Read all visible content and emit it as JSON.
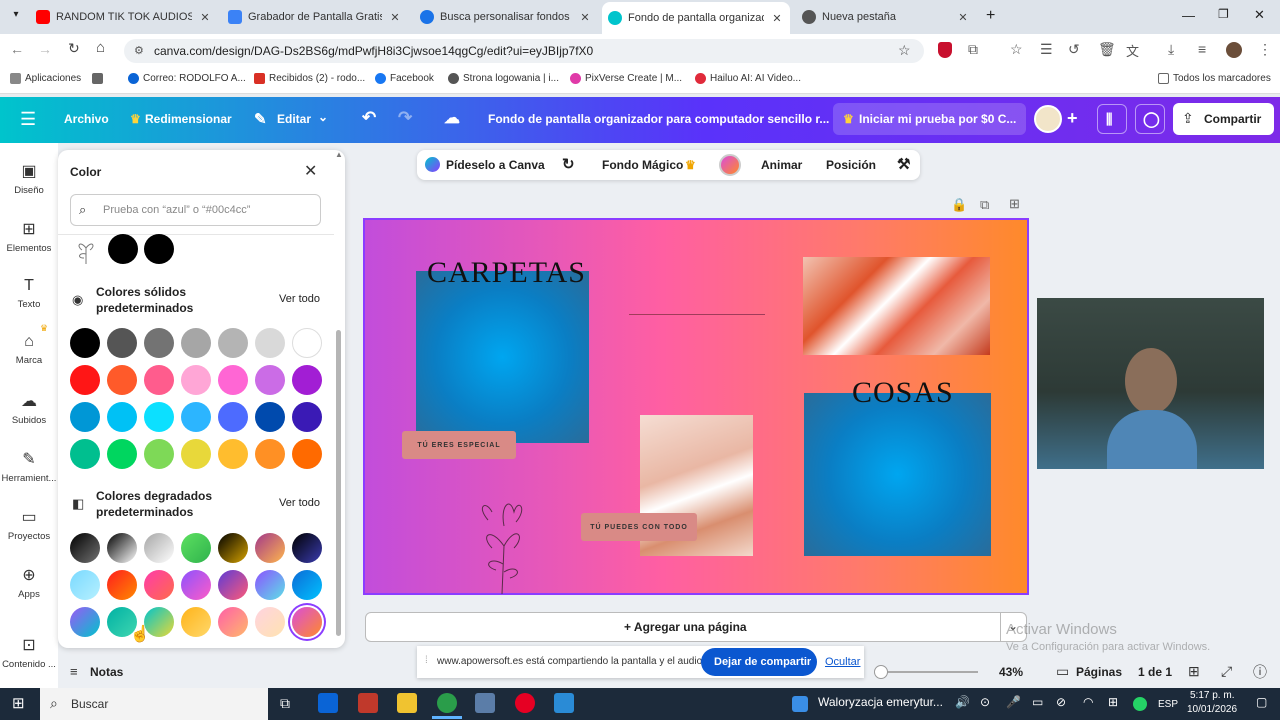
{
  "browser": {
    "tabs": [
      {
        "title": "RANDOM TIK TOK AUDIOS",
        "color": "#ff0000"
      },
      {
        "title": "Grabador de Pantalla Gratis",
        "color": "#3b82f6"
      },
      {
        "title": "Busca personalisar fondos de p",
        "color": "#1a73e8"
      },
      {
        "title": "Fondo de pantalla organizador",
        "color": "#00c4cc"
      },
      {
        "title": "Nueva pestaña",
        "color": "#555555"
      }
    ],
    "new_tab": "+",
    "url": "canva.com/design/DAG-Ds2BS6g/mdPwfjH8i3Cjwsoe14qgCg/edit?ui=eyJBIjp7fX0",
    "bookmarks": [
      "Aplicaciones",
      "Correo: RODOLFO A...",
      "Recibidos (2) - rodo...",
      "Facebook",
      "Strona logowania | i...",
      "PixVerse Create | M...",
      "Hailuo AI: AI Video...",
      "Todos los marcadores"
    ]
  },
  "canva_header": {
    "archivo": "Archivo",
    "redimensionar": "Redimensionar",
    "editar": "Editar",
    "doc_title": "Fondo de pantalla organizador para computador sencillo r...",
    "trial": "Iniciar mi prueba por $0 C...",
    "share": "Compartir"
  },
  "rail": [
    "Diseño",
    "Elementos",
    "Texto",
    "Marca",
    "Subidos",
    "Herramient...",
    "Proyectos",
    "Apps",
    "Contenido ..."
  ],
  "panel": {
    "title": "Color",
    "search_placeholder": "Prueba con “azul” o “#00c4cc”",
    "solid_title": "Colores sólidos predeterminados",
    "gradient_title": "Colores degradados predeterminados",
    "see_all": "Ver todo",
    "solid_colors": [
      [
        "#000000",
        "#555555",
        "#737373",
        "#a6a6a6",
        "#b4b4b4",
        "#d9d9d9",
        "#ffffff"
      ],
      [
        "#ff1616",
        "#ff5a2a",
        "#ff5c8d",
        "#ffa6d6",
        "#ff66d4",
        "#cb6ce6",
        "#a21ed4"
      ],
      [
        "#0097d6",
        "#00c1f5",
        "#0ce0ff",
        "#2cb5ff",
        "#4d6bff",
        "#004aad",
        "#3a1ab5"
      ],
      [
        "#00bf8f",
        "#00d65f",
        "#7ed957",
        "#e8d83a",
        "#ffbd2e",
        "#ff9024",
        "#ff6a00"
      ]
    ],
    "gradients": [
      [
        "#000000,#737373",
        "#000000,#ffffff",
        "#a6a6a6,#ffffff",
        "#5de060,#2fb34d",
        "#000000,#d6a200",
        "#a2378a,#ffb74d",
        "#000000,#3a3cb0"
      ],
      [
        "#7ad9ff,#b6f0ff",
        "#ff1d1d,#ff8a00",
        "#ff3bab,#ff6b4a",
        "#8c52ff,#ff5cc7",
        "#5c3bd6,#ff5a77",
        "#8c52ff,#5ce1e6",
        "#0c6bd6,#00c2ff"
      ],
      [
        "#9b59f5,#00c4cc",
        "#00b1a4,#3fd6b0",
        "#00c4cc,#e9d836",
        "#ffb319,#ffd86b",
        "#ff5fa8,#ffb86b",
        "#ffd3e0,#ffe3b0",
        "#d94dda,#ff8a2a"
      ]
    ]
  },
  "toolbar": {
    "pideselo": "Pídeselo a Canva",
    "fondo": "Fondo Mágico",
    "animar": "Animar",
    "posicion": "Posición"
  },
  "canvas": {
    "carpetas": "CARPETAS",
    "cosas": "COSAS",
    "tag1": "TÚ ERES ESPECIAL",
    "tag2": "TÚ PUEDES CON TODO"
  },
  "bottom": {
    "add_page": "+ Agregar una página",
    "share_msg": "www.apowersoft.es está compartiendo la pantalla y el audio.",
    "stop_share": "Dejar de compartir",
    "hide": "Ocultar",
    "notes": "Notas",
    "zoom": "43%",
    "pages": "Páginas",
    "page_count": "1 de 1",
    "activate1": "Activar Windows",
    "activate2": "Ve a Configuración para activar Windows."
  },
  "taskbar": {
    "search": "Buscar",
    "news": "Waloryzacja emerytur...",
    "lang": "ESP",
    "time": "5:17 p. m.",
    "date": "10/01/2026"
  }
}
